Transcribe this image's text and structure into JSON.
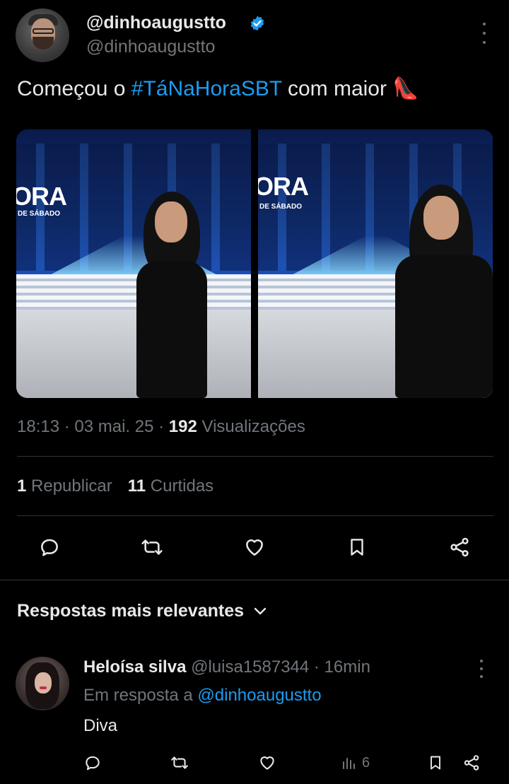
{
  "author": {
    "display_name": "@dinhoaugustto",
    "handle": "@dinhoaugustto",
    "verified": true
  },
  "tweet": {
    "text_before": "Começou o ",
    "hashtag": "#TáNaHoraSBT",
    "text_after": " com maior ",
    "emoji": "👠"
  },
  "media": [
    {
      "logo_big": "ORA",
      "logo_small": "DE SÁBADO"
    },
    {
      "logo_big": "ORA",
      "logo_small": "DE SÁBADO"
    }
  ],
  "meta": {
    "time": "18:13",
    "separator": " · ",
    "date": "03 mai. 25",
    "views_count": "192",
    "views_label": " Visualizações"
  },
  "stats": {
    "reposts_count": "1",
    "reposts_label": " Republicar",
    "likes_count": "11",
    "likes_label": " Curtidas"
  },
  "actions": [
    "reply-icon",
    "retweet-icon",
    "heart-icon",
    "bookmark-icon",
    "share-icon"
  ],
  "replies": {
    "section_title": "Respostas mais relevantes",
    "items": [
      {
        "name": "Heloísa silva",
        "handle": "@luisa1587344",
        "time": " · 16min",
        "in_reply_prefix": "Em resposta a ",
        "in_reply_to": "@dinhoaugustto",
        "text": "Diva",
        "views": "6"
      }
    ]
  },
  "colors": {
    "background": "#000000",
    "text": "#e7e9ea",
    "muted": "#71767b",
    "accent": "#1d9bf0",
    "divider": "#2f3336"
  }
}
